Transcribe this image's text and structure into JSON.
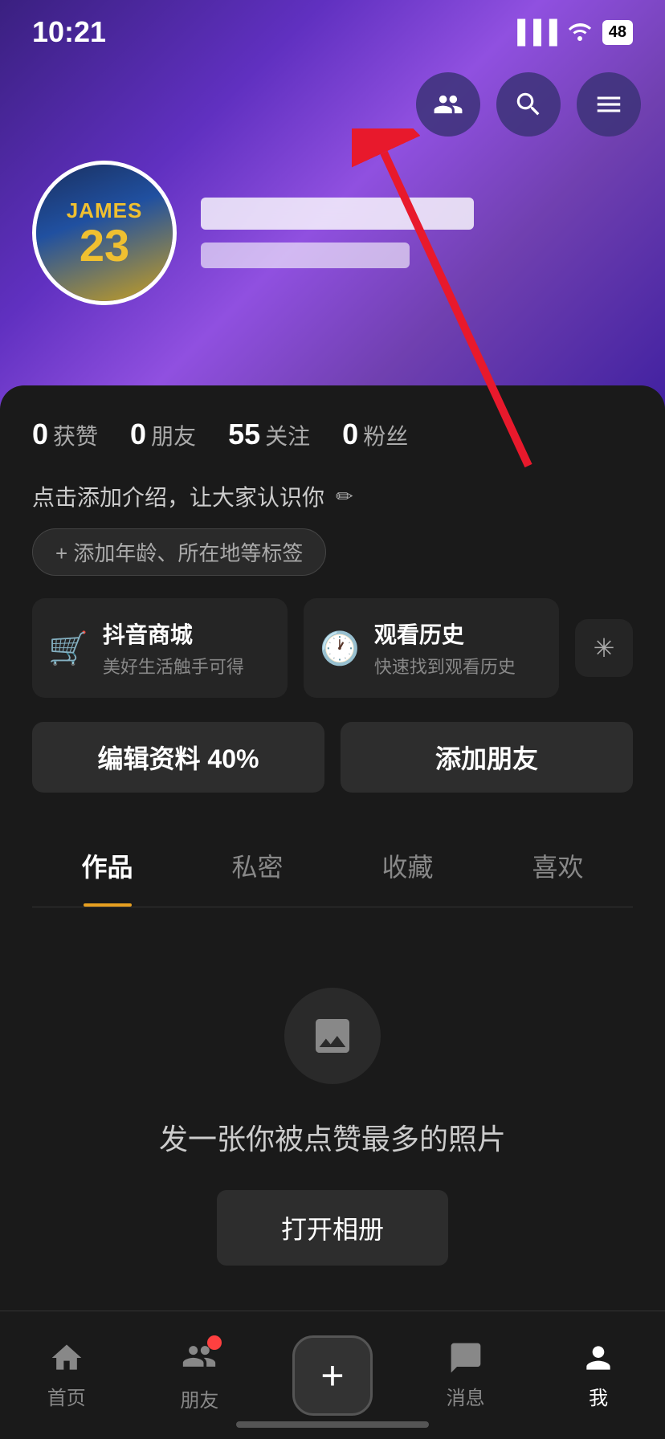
{
  "statusBar": {
    "time": "10:21",
    "battery": "48"
  },
  "topIcons": {
    "friends": "friends-icon",
    "search": "search-icon",
    "menu": "menu-icon"
  },
  "profile": {
    "jerseyName": "JAMES",
    "jerseyNumber": "23",
    "usernameBlurred": true,
    "useridBlurred": true
  },
  "stats": [
    {
      "number": "0",
      "label": "获赞"
    },
    {
      "number": "0",
      "label": "朋友"
    },
    {
      "number": "55",
      "label": "关注"
    },
    {
      "number": "0",
      "label": "粉丝"
    }
  ],
  "bio": {
    "addBioText": "点击添加介绍，让大家认识你",
    "addTagText": "+ 添加年龄、所在地等标签"
  },
  "features": [
    {
      "icon": "cart",
      "title": "抖音商城",
      "subtitle": "美好生活触手可得"
    },
    {
      "icon": "clock",
      "title": "观看历史",
      "subtitle": "快速找到观看历史"
    }
  ],
  "featureExtra": "✳",
  "actions": {
    "editProfile": "编辑资料 40%",
    "addFriend": "添加朋友"
  },
  "tabs": [
    "作品",
    "私密",
    "收藏",
    "喜欢"
  ],
  "activeTab": 0,
  "emptyState": {
    "title": "发一张你被点赞最多的照片",
    "buttonText": "打开相册"
  },
  "bottomNav": [
    {
      "label": "首页",
      "active": false
    },
    {
      "label": "朋友",
      "active": false,
      "dot": true
    },
    {
      "label": "",
      "active": false,
      "isPlus": true
    },
    {
      "label": "消息",
      "active": false
    },
    {
      "label": "我",
      "active": true
    }
  ]
}
